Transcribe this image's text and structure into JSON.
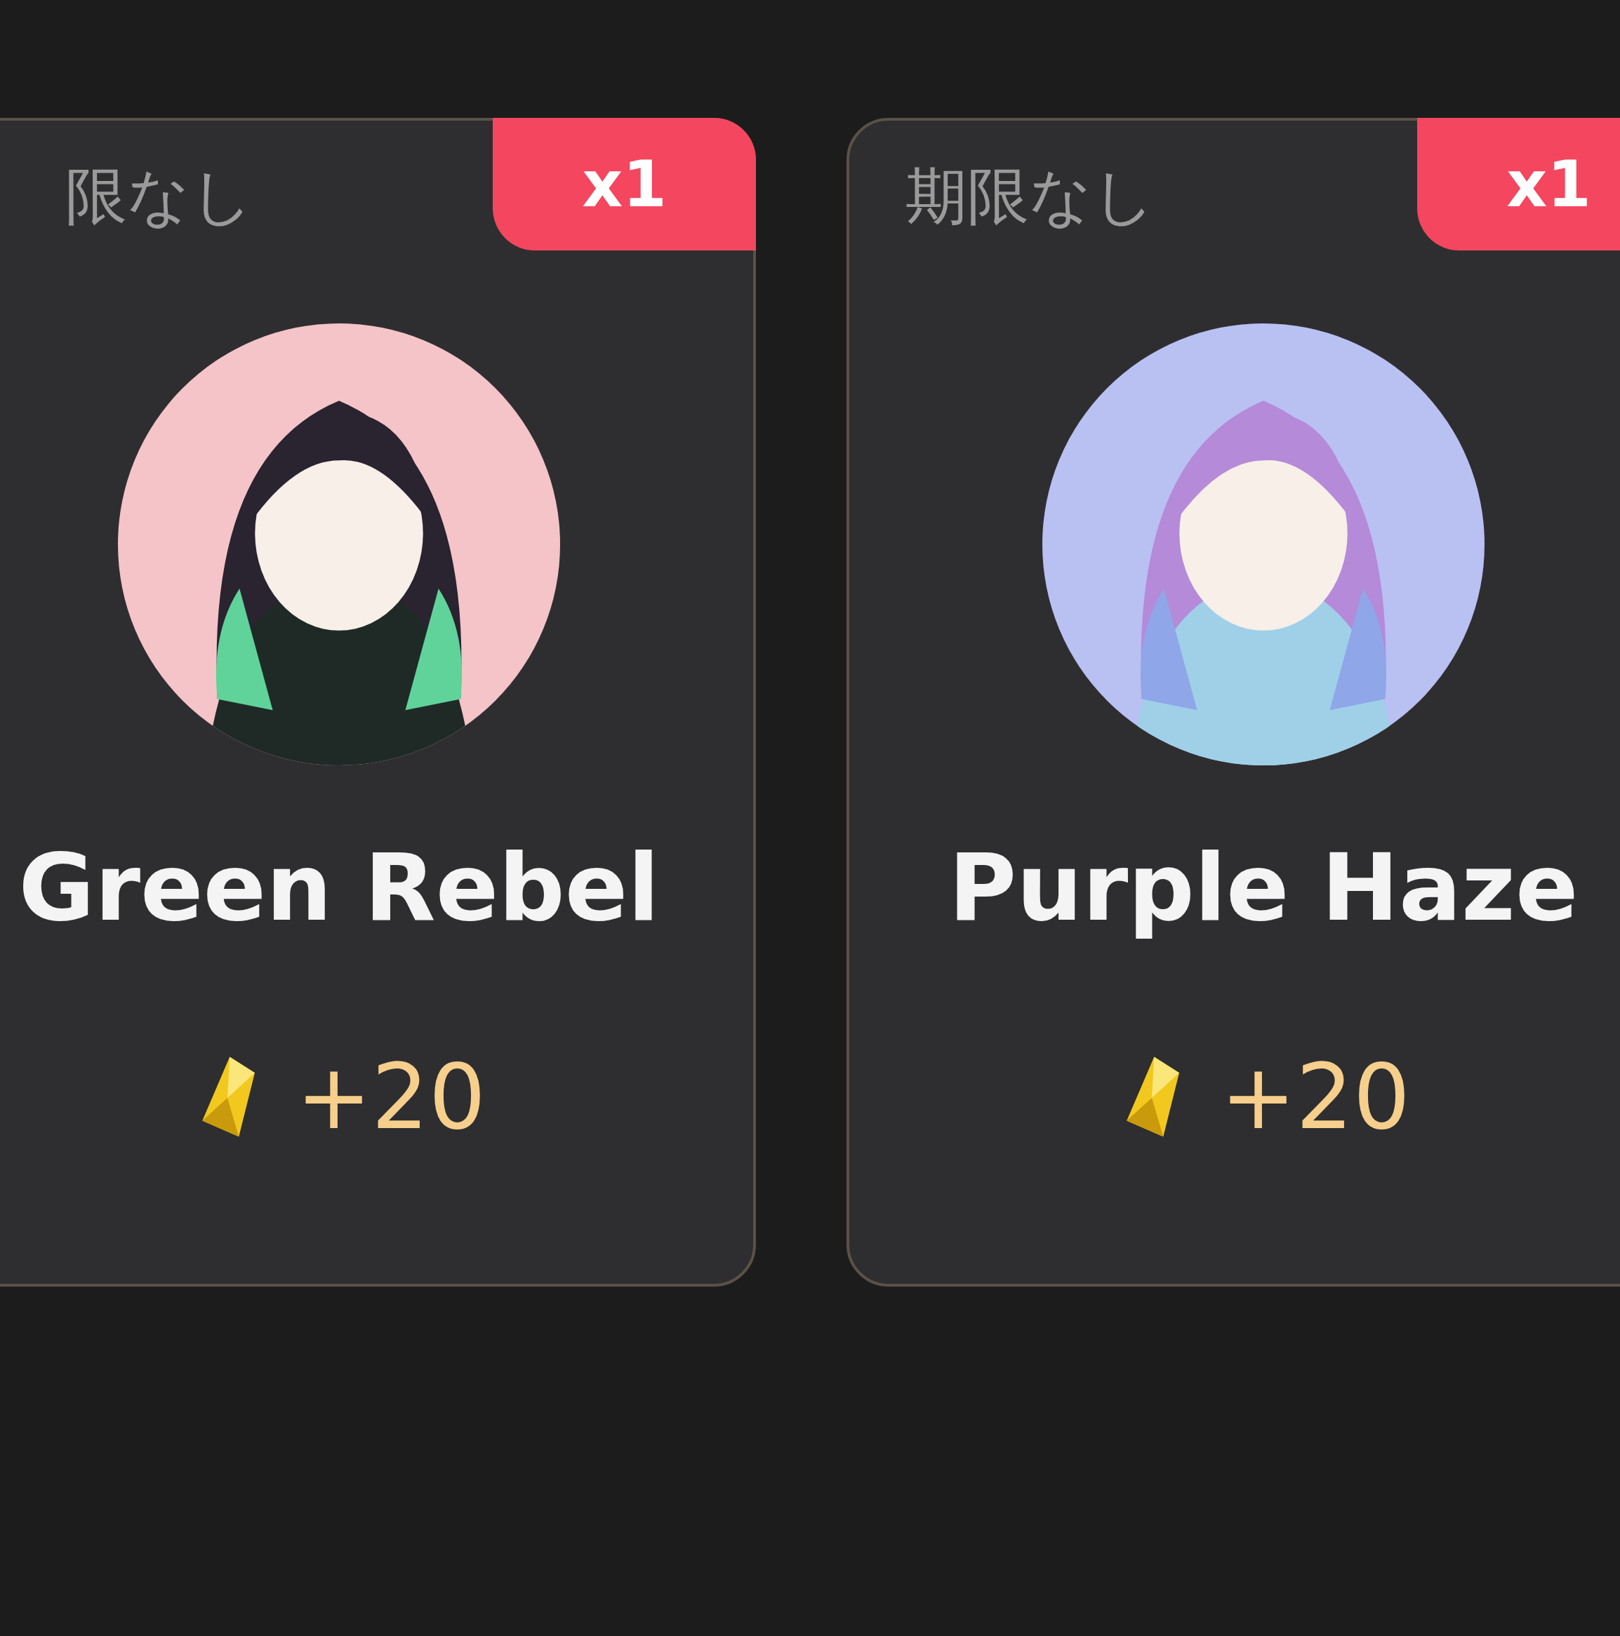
{
  "cards": [
    {
      "expiry": "限なし",
      "count": "x1",
      "name": "Green Rebel",
      "reward": "+20"
    },
    {
      "expiry": "期限なし",
      "count": "x1",
      "name": "Purple Haze",
      "reward": "+20"
    }
  ]
}
